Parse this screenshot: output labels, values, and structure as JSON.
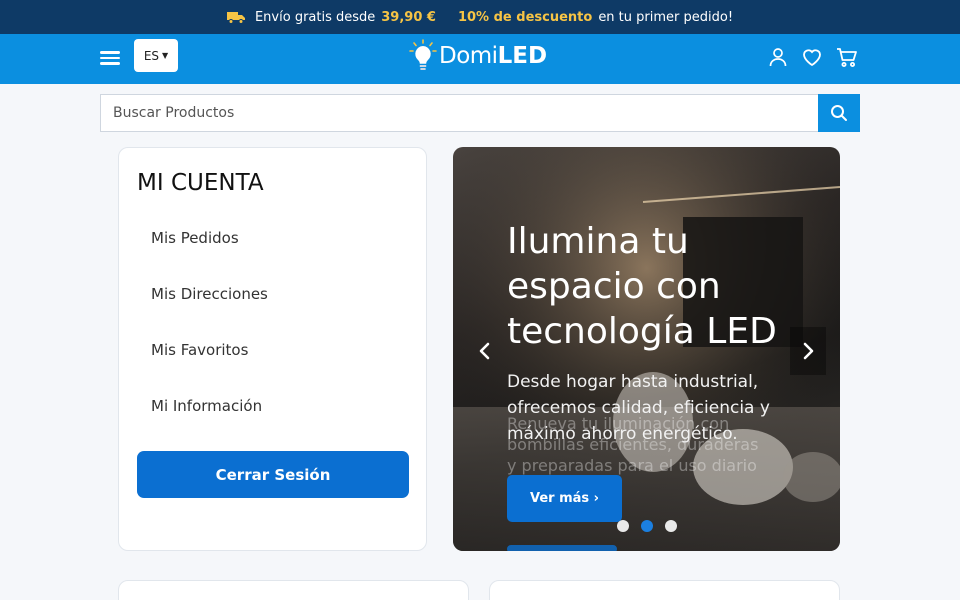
{
  "promo": {
    "text1": "Envío gratis desde",
    "amount": "39,90 €",
    "discount": "10% de descuento",
    "text2": "en tu primer pedido!"
  },
  "header": {
    "lang": "ES",
    "logo_text_light": "Domi",
    "logo_text_bold": "LED",
    "icons": [
      "menu-icon",
      "user-icon",
      "heart-icon",
      "cart-icon"
    ]
  },
  "search": {
    "placeholder": "Buscar Productos"
  },
  "account": {
    "title": "MI CUENTA",
    "items": [
      "Mis Pedidos",
      "Mis Direcciones",
      "Mis Favoritos",
      "Mi Información"
    ],
    "logout": "Cerrar Sesión"
  },
  "hero": {
    "title": "Ilumina tu espacio con tecnología LED",
    "description": "Desde hogar hasta industrial, ofrecemos calidad, eficiencia y máximo ahorro energético.",
    "ghost_text": "Renueva tu iluminación con bombillas eficientes, duraderas y preparadas para el uso diario",
    "cta": "Ver más ›",
    "active_slide": 2,
    "slide_count": 3
  },
  "colors": {
    "promo_bg": "#0e3a66",
    "header_bg": "#0b8fe0",
    "accent": "#f6c445",
    "button": "#0b6fd1"
  }
}
